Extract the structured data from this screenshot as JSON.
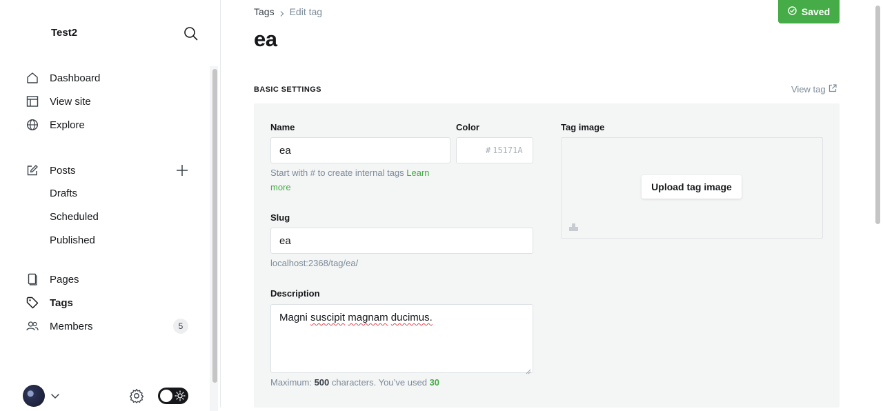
{
  "sidebar": {
    "site_title": "Test2",
    "nav": {
      "dashboard": "Dashboard",
      "view_site": "View site",
      "explore": "Explore",
      "posts": "Posts",
      "drafts": "Drafts",
      "scheduled": "Scheduled",
      "published": "Published",
      "pages": "Pages",
      "tags": "Tags",
      "members": "Members",
      "members_count": "5"
    }
  },
  "header": {
    "breadcrumb": {
      "parent": "Tags",
      "current": "Edit tag"
    },
    "title": "ea",
    "saved_label": "Saved"
  },
  "section": {
    "title": "BASIC SETTINGS",
    "view_tag": "View tag"
  },
  "form": {
    "name": {
      "label": "Name",
      "value": "ea",
      "hint_prefix": "Start with # to create internal tags",
      "hint_link_1": "Learn",
      "hint_link_2": "more"
    },
    "color": {
      "label": "Color",
      "hash": "#",
      "placeholder": "15171A"
    },
    "tag_image": {
      "label": "Tag image",
      "upload_label": "Upload tag image"
    },
    "slug": {
      "label": "Slug",
      "value": "ea",
      "url": "localhost:2368/tag/ea/"
    },
    "description": {
      "label": "Description",
      "words": [
        "Magni",
        "suscipit",
        "magnam",
        "ducimus."
      ],
      "counter_prefix": "Maximum:",
      "max": "500",
      "counter_mid": "characters. You’ve used",
      "used": "30"
    }
  },
  "colors": {
    "accent_green": "#46ac47",
    "text_dark": "#15171a",
    "muted": "#7c8b9a",
    "panel_bg": "#f4f5f5"
  }
}
